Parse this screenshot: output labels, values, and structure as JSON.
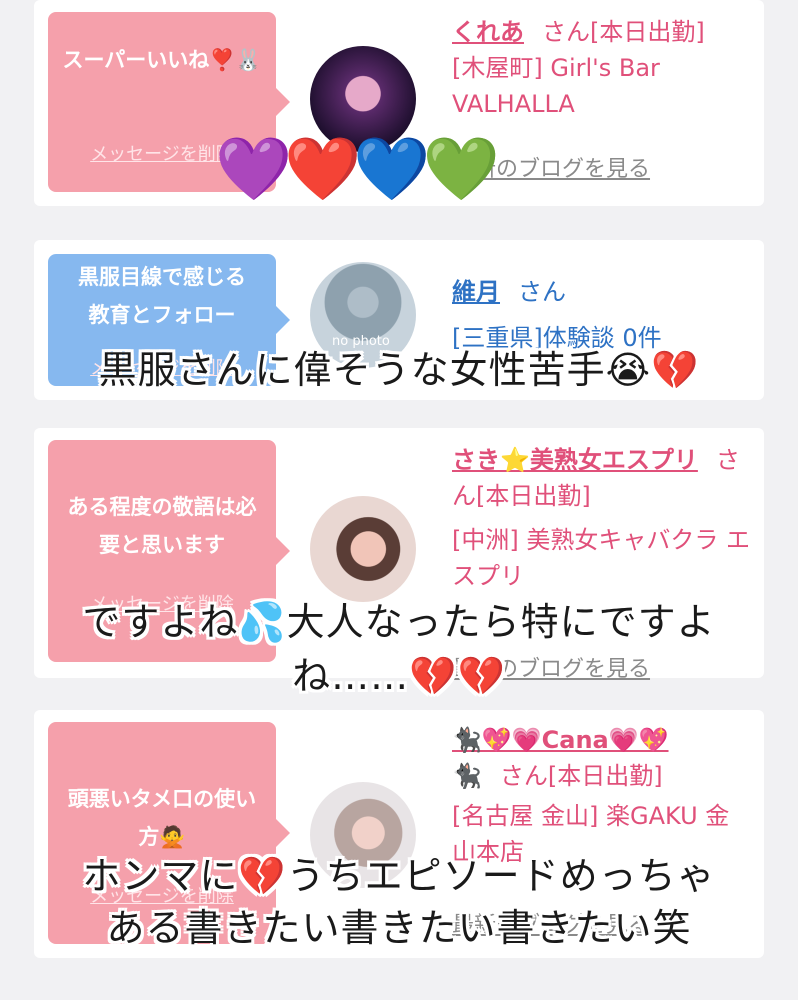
{
  "cards": [
    {
      "bubble": "スーパーいいね❣️🐰",
      "delete": "メッセージを削除",
      "name": "くれあ",
      "san": "さん[本日出勤]",
      "shop_line": "[木屋町] Girl's Bar VALHALLA",
      "blog": "最新のブログを見る"
    },
    {
      "bubble": "黒服目線で感じる教育とフォロー",
      "delete": "メッセージを削除",
      "name": "維月",
      "san": "さん",
      "shop_line": "[三重県]体験談 0件",
      "avatar_text": "no photo"
    },
    {
      "bubble": "ある程度の敬語は必要と思います",
      "delete": "メッセージを削除",
      "name": "さき⭐️美熟女エスプリ",
      "san": "さん[本日出勤]",
      "shop_line": "[中洲] 美熟女キャバクラ エスプリ",
      "blog": "最新のブログを見る"
    },
    {
      "bubble": "頭悪いタメ口の使い方🙅",
      "delete": "メッセージを削除",
      "name": "🐈‍⬛💖💗Cana💗💖",
      "name_line2": "🐈‍⬛",
      "san": "さん[本日出勤]",
      "shop_line": "[名古屋 金山] 楽GAKU 金山本店",
      "blog": "最新のブログを見る"
    }
  ],
  "overlay": {
    "hearts": "💜❤️💙💚",
    "caption1": "黒服さんに偉そうな女性苦手😭💔",
    "caption2_line1": "ですよね💦大人なったら特にですよ",
    "caption2_line2": "ね……💔💔",
    "caption3_line1": "ホンマに💔うちエピソードめっちゃ",
    "caption3_line2": "ある書きたい書きたい書きたい笑"
  },
  "colors": {
    "pink": "#f5a0ab",
    "blue": "#86b8ef",
    "name_pink": "#e0507a",
    "name_blue": "#2e72c4"
  }
}
